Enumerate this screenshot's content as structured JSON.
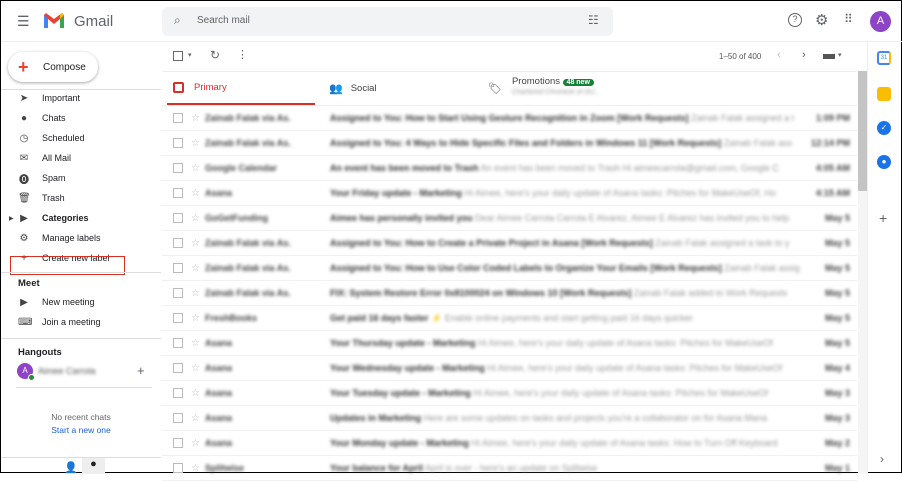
{
  "header": {
    "app_name": "Gmail",
    "search_placeholder": "Search mail",
    "avatar_letter": "A"
  },
  "compose_label": "Compose",
  "sidebar": {
    "items": [
      {
        "label": "Important",
        "icon": "important-icon"
      },
      {
        "label": "Chats",
        "icon": "chat-icon"
      },
      {
        "label": "Scheduled",
        "icon": "clock-icon"
      },
      {
        "label": "All Mail",
        "icon": "mail-icon"
      },
      {
        "label": "Spam",
        "icon": "spam-icon"
      },
      {
        "label": "Trash",
        "icon": "trash-icon"
      },
      {
        "label": "Categories",
        "icon": "label-icon"
      },
      {
        "label": "Manage labels",
        "icon": "gear-icon"
      },
      {
        "label": "Create new label",
        "icon": "plus-icon"
      }
    ],
    "meet_title": "Meet",
    "meet_items": [
      "New meeting",
      "Join a meeting"
    ],
    "hangouts_title": "Hangouts",
    "hangouts_user": "Aimee Carrola",
    "no_chats": "No recent chats",
    "start_new": "Start a new one"
  },
  "toolbar": {
    "pagination": "1–50 of 400"
  },
  "tabs": [
    {
      "label": "Primary"
    },
    {
      "label": "Social"
    },
    {
      "label": "Promotions",
      "badge": "48 new",
      "sub": "Chartered Chronicle of OU.."
    }
  ],
  "accent": "#d93025",
  "emails": [
    {
      "sender": "Zainab Falak via As.",
      "subject": "Assigned to You: How to Start Using Gesture Recognition in Zoom [Work Requests]",
      "snippet": "Zainab Falak assigned a t",
      "date": "1:09 PM"
    },
    {
      "sender": "Zainab Falak via As.",
      "subject": "Assigned to You: 4 Ways to Hide Specific Files and Folders in Windows 11 [Work Requests]",
      "snippet": "Zainab Falak ass",
      "date": "12:14 PM"
    },
    {
      "sender": "Google Calendar",
      "subject": "An event has been moved to Trash",
      "snippet": "An event has been moved to Trash Hi aimeecarrola@gmail.com, Google C",
      "date": "4:05 AM"
    },
    {
      "sender": "Asana",
      "subject": "Your Friday update - Marketing",
      "snippet": "Hi Aimee, here's your daily update of Asana tasks: Pitches for MakeUseOf, Ho",
      "date": "4:15 AM"
    },
    {
      "sender": "GoGetFunding",
      "subject": "Aimee has personally invited you",
      "snippet": "Dear Aimee Carrola Carrola E Alvarez, Aimee E Alvarez has invited you to help",
      "date": "May 5"
    },
    {
      "sender": "Zainab Falak via As.",
      "subject": "Assigned to You: How to Create a Private Project in Asana [Work Requests]",
      "snippet": "Zainab Falak assigned a task to y",
      "date": "May 5"
    },
    {
      "sender": "Zainab Falak via As.",
      "subject": "Assigned to You: How to Use Color Coded Labels to Organize Your Emails [Work Requests]",
      "snippet": "Zainab Falak assig",
      "date": "May 5"
    },
    {
      "sender": "Zainab Falak via As.",
      "subject": "FIX: System Restore Error 0x8100024 on Windows 10 [Work Requests]",
      "snippet": "Zainab Falak added to Work Requests",
      "date": "May 5"
    },
    {
      "sender": "FreshBooks",
      "subject": "Get paid 16 days faster ⚡",
      "snippet": "Enable online payments and start getting paid 16 days quicker",
      "date": "May 5"
    },
    {
      "sender": "Asana",
      "subject": "Your Thursday update - Marketing",
      "snippet": "Hi Aimee, here's your daily update of Asana tasks: Pitches for MakeUseOf",
      "date": "May 5"
    },
    {
      "sender": "Asana",
      "subject": "Your Wednesday update - Marketing",
      "snippet": "Hi Aimee, here's your daily update of Asana tasks: Pitches for MakeUseOf",
      "date": "May 4"
    },
    {
      "sender": "Asana",
      "subject": "Your Tuesday update - Marketing",
      "snippet": "Hi Aimee, here's your daily update of Asana tasks: Pitches for MakeUseOf",
      "date": "May 3"
    },
    {
      "sender": "Asana",
      "subject": "Updates in Marketing",
      "snippet": "Here are some updates on tasks and projects you're a collaborator on for Asana Mana",
      "date": "May 3"
    },
    {
      "sender": "Asana",
      "subject": "Your Monday update - Marketing",
      "snippet": "Hi Aimee, here's your daily update of Asana tasks: How to Turn Off Keyboard",
      "date": "May 2"
    },
    {
      "sender": "Splitwise",
      "subject": "Your balance for April",
      "snippet": "April is over - here's an update on Splitwise",
      "date": "May 1"
    }
  ]
}
